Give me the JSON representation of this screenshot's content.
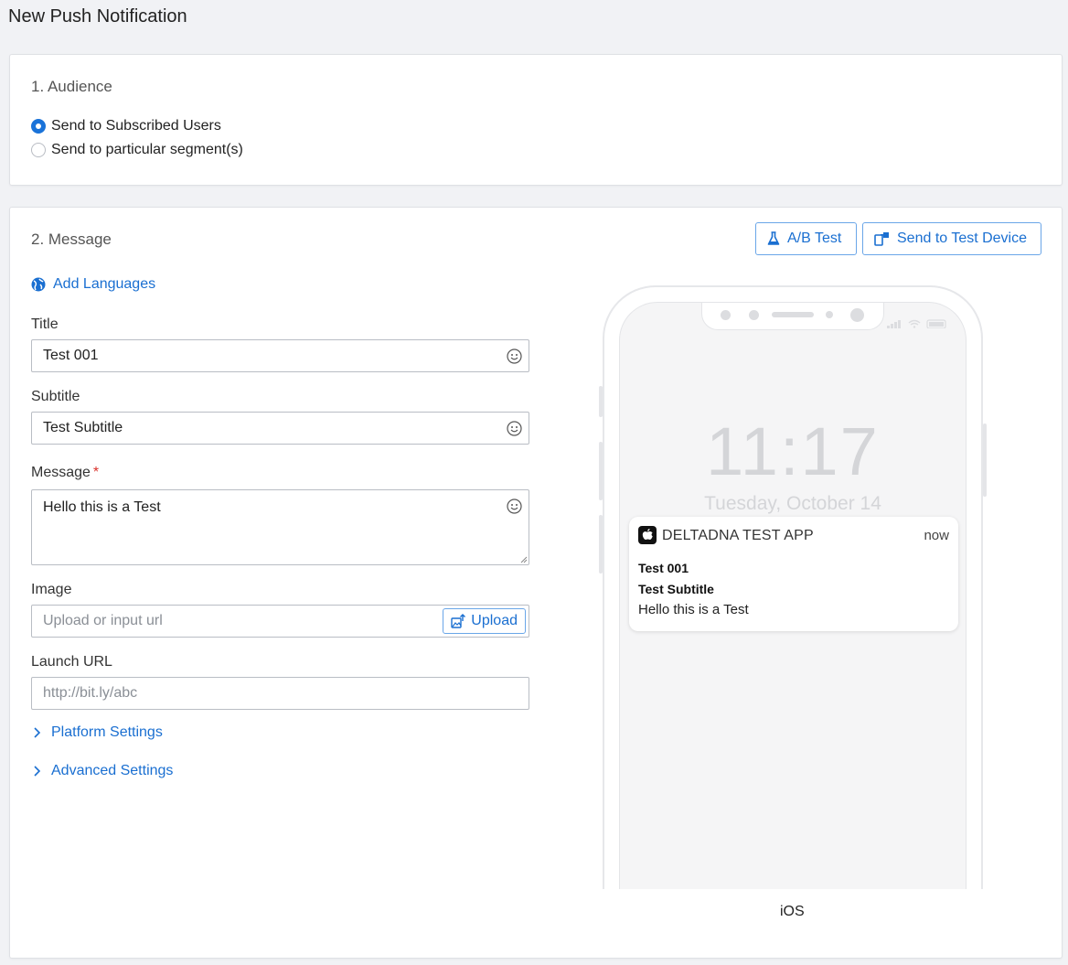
{
  "page": {
    "title": "New Push Notification"
  },
  "audience": {
    "heading": "1. Audience",
    "options": [
      {
        "label": "Send to Subscribed Users",
        "checked": true
      },
      {
        "label": "Send to particular segment(s)",
        "checked": false
      }
    ]
  },
  "message": {
    "heading": "2. Message",
    "ab_test_label": "A/B Test",
    "send_test_label": "Send to Test Device",
    "add_languages_label": "Add Languages",
    "title_label": "Title",
    "title_value": "Test 001",
    "subtitle_label": "Subtitle",
    "subtitle_value": "Test Subtitle",
    "message_label": "Message",
    "required_mark": "*",
    "message_value": "Hello this is a Test",
    "image_label": "Image",
    "image_placeholder": "Upload or input url",
    "upload_label": "Upload",
    "launch_url_label": "Launch URL",
    "launch_url_placeholder": "http://bit.ly/abc",
    "platform_settings_label": "Platform Settings",
    "advanced_settings_label": "Advanced Settings"
  },
  "preview": {
    "clock": "11:17",
    "date": "Tuesday, October 14",
    "app_name": "DELTADNA TEST APP",
    "time": "now",
    "notif_title": "Test 001",
    "notif_subtitle": "Test Subtitle",
    "notif_body": "Hello this is a Test",
    "platform": "iOS"
  },
  "colors": {
    "accent": "#1a6fd1",
    "required": "#d9322c"
  },
  "icons": [
    "flask-icon",
    "test-device-icon",
    "globe-icon",
    "emoji-icon",
    "upload-image-icon",
    "chevron-right-icon",
    "apple-icon"
  ]
}
